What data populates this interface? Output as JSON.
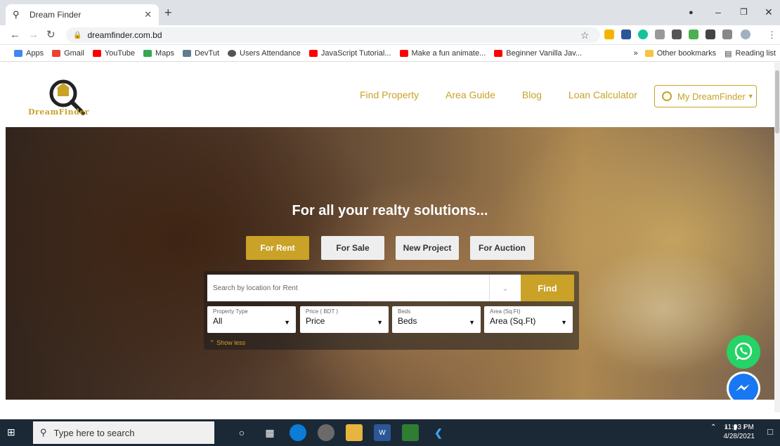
{
  "browser": {
    "tab_title": "Dream Finder",
    "url": "dreamfinder.com.bd"
  },
  "bookmarks": [
    {
      "label": "Apps",
      "color": "#4285f4"
    },
    {
      "label": "Gmail",
      "color": "#ea4335"
    },
    {
      "label": "YouTube",
      "color": "#ff0000"
    },
    {
      "label": "Maps",
      "color": "#34a853"
    },
    {
      "label": "DevTut",
      "color": "#607d8b"
    },
    {
      "label": "Users Attendance",
      "color": "#555555"
    },
    {
      "label": "JavaScript Tutorial...",
      "color": "#ff0000"
    },
    {
      "label": "Make a fun animate...",
      "color": "#ff0000"
    },
    {
      "label": "Beginner Vanilla Jav...",
      "color": "#ff0000"
    }
  ],
  "bookmarks_right": {
    "other": "Other bookmarks",
    "reading": "Reading list"
  },
  "site": {
    "logo_text": "DreamFinder",
    "nav": [
      "Find Property",
      "Area Guide",
      "Blog",
      "Loan Calculator"
    ],
    "account_button": "My DreamFinder",
    "accent": "#c9a227"
  },
  "hero": {
    "title": "For all your realty solutions...",
    "modes": [
      "For Rent",
      "For Sale",
      "New Project",
      "For Auction"
    ],
    "active_mode": "For Rent",
    "search_placeholder": "Search by location for Rent",
    "find_label": "Find",
    "filters": [
      {
        "label": "Property Type",
        "value": "All"
      },
      {
        "label": "Price ( BDT )",
        "value": "Price"
      },
      {
        "label": "Beds",
        "value": "Beds"
      },
      {
        "label": "Area (Sq.Ft)",
        "value": "Area (Sq.Ft)"
      }
    ],
    "show_less": "Show less"
  },
  "taskbar": {
    "search_placeholder": "Type here to search",
    "time": "11:03 PM",
    "date": "4/28/2021"
  }
}
